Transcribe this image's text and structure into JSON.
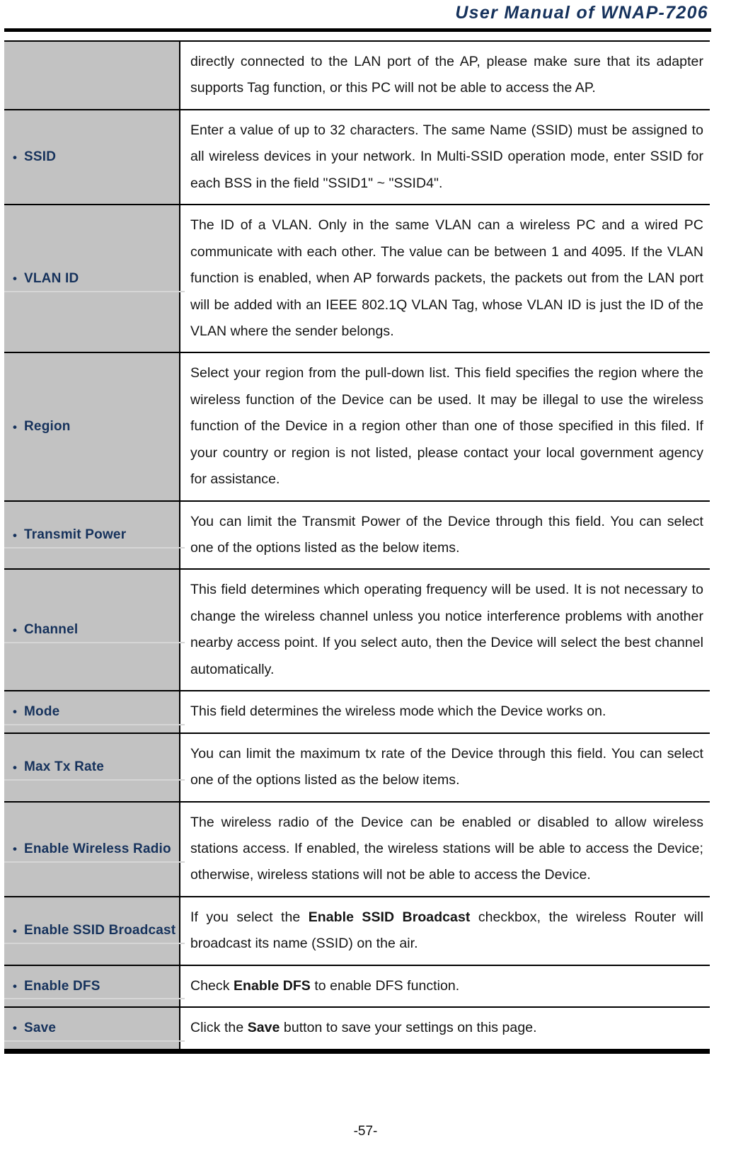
{
  "header": {
    "title": "User Manual of WNAP-7206"
  },
  "footer": {
    "page_number": "-57-"
  },
  "table": {
    "bullet_glyph": "•",
    "label_color": "#16325c",
    "label_cell_background": "#c2c2c2",
    "rows": [
      {
        "label": "",
        "description_prefix": "directly connected to the LAN port of the AP, please make sure that its adapter supports Tag function, or this PC will not be able to access the AP.",
        "description_bold": "",
        "description_suffix": ""
      },
      {
        "label": "SSID",
        "description_prefix": "Enter a value of up to 32 characters. The same Name (SSID) must be assigned to all wireless devices in your network. In Multi-SSID operation mode, enter SSID for each BSS in the field \"SSID1\" ~ \"SSID4\".",
        "description_bold": "",
        "description_suffix": ""
      },
      {
        "label": "VLAN ID",
        "description_prefix": "The ID of a VLAN. Only in the same VLAN can a wireless PC and a wired PC communicate with each other. The value can be between 1 and 4095. If the VLAN function is enabled, when AP forwards packets, the packets out from the LAN port will be added with an IEEE 802.1Q VLAN Tag, whose VLAN ID is just the ID of the VLAN where the sender belongs.",
        "description_bold": "",
        "description_suffix": ""
      },
      {
        "label": "Region",
        "description_prefix": "Select your region from the pull-down list. This field specifies the region where the wireless function of the Device can be used. It may be illegal to use the wireless function of the Device in a region other than one of those specified in this filed. If your country or region is not listed, please contact your local government agency for assistance.",
        "description_bold": "",
        "description_suffix": ""
      },
      {
        "label": "Transmit Power",
        "description_prefix": "You can limit the Transmit Power of the Device through this field. You can select one of the options listed as the below items.",
        "description_bold": "",
        "description_suffix": ""
      },
      {
        "label": "Channel",
        "description_prefix": "This field determines which operating frequency will be used. It is not necessary to change the wireless channel unless you notice interference problems with another nearby access point. If you select auto, then the Device will select the best channel automatically.",
        "description_bold": "",
        "description_suffix": ""
      },
      {
        "label": "Mode",
        "description_prefix": "This field determines the wireless mode which the Device works on.",
        "description_bold": "",
        "description_suffix": ""
      },
      {
        "label": "Max Tx Rate",
        "description_prefix": "You can limit the maximum tx rate of the Device through this field. You can select one of the options listed as the below items.",
        "description_bold": "",
        "description_suffix": ""
      },
      {
        "label": "Enable Wireless Radio",
        "description_prefix": "The wireless radio of the Device can be enabled or disabled to allow wireless stations access. If enabled, the wireless stations will be able to access the Device; otherwise, wireless stations will not be able to access the Device.",
        "description_bold": "",
        "description_suffix": ""
      },
      {
        "label": "Enable SSID Broadcast",
        "description_prefix": "If you select the ",
        "description_bold": "Enable SSID Broadcast",
        "description_suffix": " checkbox, the wireless Router will broadcast its name (SSID) on the air."
      },
      {
        "label": "Enable DFS",
        "description_prefix": "Check ",
        "description_bold": "Enable DFS",
        "description_suffix": " to enable DFS function."
      },
      {
        "label": "Save",
        "description_prefix": "Click the ",
        "description_bold": "Save",
        "description_suffix": " button to save your settings on this page."
      }
    ]
  }
}
